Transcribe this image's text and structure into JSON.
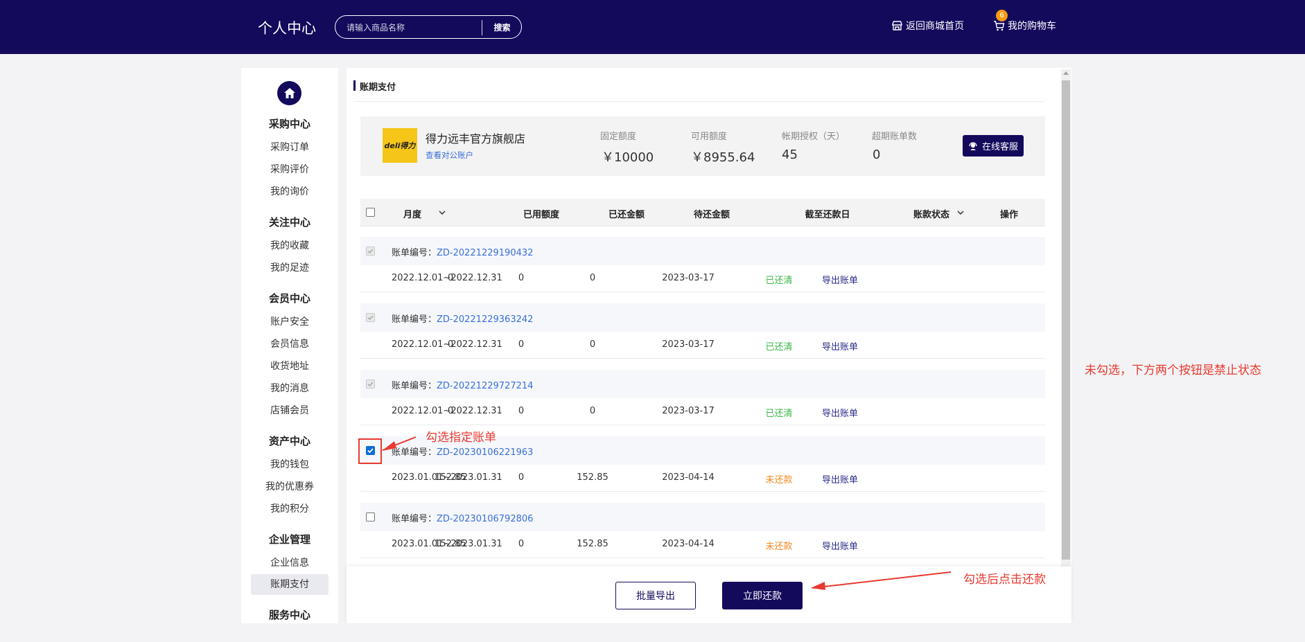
{
  "header": {
    "title": "个人中心",
    "search_placeholder": "请输入商品名称",
    "search_button": "搜索",
    "back_to_mall": "返回商城首页",
    "cart_label": "我的购物车",
    "cart_count": "6"
  },
  "sidebar": {
    "groups": [
      {
        "title": "采购中心",
        "items": [
          "采购订单",
          "采购评价",
          "我的询价"
        ]
      },
      {
        "title": "关注中心",
        "items": [
          "我的收藏",
          "我的足迹"
        ]
      },
      {
        "title": "会员中心",
        "items": [
          "账户安全",
          "会员信息",
          "收货地址",
          "我的消息",
          "店铺会员"
        ]
      },
      {
        "title": "资产中心",
        "items": [
          "我的钱包",
          "我的优惠券",
          "我的积分"
        ]
      },
      {
        "title": "企业管理",
        "items": [
          "企业信息",
          "账期支付"
        ]
      },
      {
        "title": "服务中心",
        "items": []
      }
    ],
    "active_item": "账期支付"
  },
  "page": {
    "section_title": "账期支付"
  },
  "store": {
    "logo_text": "deli得力",
    "name": "得力远丰官方旗舰店",
    "account_link": "查看对公账户",
    "stats": [
      {
        "label": "固定额度",
        "value": "￥10000"
      },
      {
        "label": "可用额度",
        "value": "￥8955.64"
      },
      {
        "label": "帐期授权（天）",
        "value": "45"
      },
      {
        "label": "超期账单数",
        "value": "0"
      }
    ],
    "service_button": "在线客服"
  },
  "table": {
    "columns": [
      "月度",
      "已用额度",
      "已还金额",
      "待还金额",
      "截至还款日",
      "账款状态",
      "操作"
    ],
    "bill_label": "账单编号：",
    "rows": [
      {
        "bill_no": "ZD-20221229190432",
        "period": "2022.12.01~2022.12.31",
        "used": "0",
        "repaid": "0",
        "pending": "0",
        "due": "2023-03-17",
        "status": "已还清",
        "status_type": "paid",
        "action": "导出账单",
        "checkbox": "disabled"
      },
      {
        "bill_no": "ZD-20221229363242",
        "period": "2022.12.01~2022.12.31",
        "used": "0",
        "repaid": "0",
        "pending": "0",
        "due": "2023-03-17",
        "status": "已还清",
        "status_type": "paid",
        "action": "导出账单",
        "checkbox": "disabled"
      },
      {
        "bill_no": "ZD-20221229727214",
        "period": "2022.12.01~2022.12.31",
        "used": "0",
        "repaid": "0",
        "pending": "0",
        "due": "2023-03-17",
        "status": "已还清",
        "status_type": "paid",
        "action": "导出账单",
        "checkbox": "disabled"
      },
      {
        "bill_no": "ZD-20230106221963",
        "period": "2023.01.01~2023.01.31",
        "used": "152.85",
        "repaid": "0",
        "pending": "152.85",
        "due": "2023-04-14",
        "status": "未还款",
        "status_type": "unpaid",
        "action": "导出账单",
        "checkbox": "checked"
      },
      {
        "bill_no": "ZD-20230106792806",
        "period": "2023.01.01~2023.01.31",
        "used": "152.85",
        "repaid": "0",
        "pending": "152.85",
        "due": "2023-04-14",
        "status": "未还款",
        "status_type": "unpaid",
        "action": "导出账单",
        "checkbox": "unchecked"
      }
    ]
  },
  "footer": {
    "batch_export": "批量导出",
    "pay_now": "立即还款"
  },
  "annotations": {
    "select_bill": "勾选指定账单",
    "disabled_note": "未勾选，下方两个按钮是禁止状态",
    "click_pay": "勾选后点击还款"
  },
  "colors": {
    "brand": "#130a5c",
    "link": "#3a6fd8",
    "paid": "#3cb54a",
    "unpaid": "#f0891e",
    "annotation": "#e8392e"
  }
}
